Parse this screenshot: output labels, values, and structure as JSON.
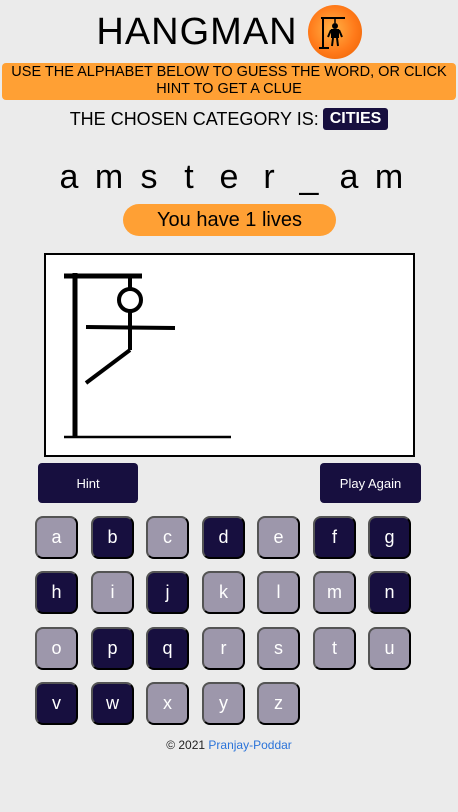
{
  "header": {
    "title": "HANGMAN",
    "logo_icon": "hangman-logo-icon"
  },
  "instructions": "USE THE ALPHABET BELOW TO GUESS THE WORD, OR CLICK HINT TO GET A CLUE",
  "category": {
    "label": "THE CHOSEN CATEGORY IS:",
    "value": "CITIES"
  },
  "word": [
    "a",
    "m",
    "s",
    "t",
    "e",
    "r",
    "_",
    "a",
    "m"
  ],
  "lives_text": "You have 1 lives",
  "buttons": {
    "hint": "Hint",
    "play_again": "Play Again"
  },
  "keyboard": [
    {
      "letter": "a",
      "used": true
    },
    {
      "letter": "b",
      "used": false
    },
    {
      "letter": "c",
      "used": true
    },
    {
      "letter": "d",
      "used": false
    },
    {
      "letter": "e",
      "used": true
    },
    {
      "letter": "f",
      "used": false
    },
    {
      "letter": "g",
      "used": false
    },
    {
      "letter": "h",
      "used": false
    },
    {
      "letter": "i",
      "used": true
    },
    {
      "letter": "j",
      "used": false
    },
    {
      "letter": "k",
      "used": true
    },
    {
      "letter": "l",
      "used": true
    },
    {
      "letter": "m",
      "used": true
    },
    {
      "letter": "n",
      "used": false
    },
    {
      "letter": "o",
      "used": true
    },
    {
      "letter": "p",
      "used": false
    },
    {
      "letter": "q",
      "used": false
    },
    {
      "letter": "r",
      "used": true
    },
    {
      "letter": "s",
      "used": true
    },
    {
      "letter": "t",
      "used": true
    },
    {
      "letter": "u",
      "used": true
    },
    {
      "letter": "v",
      "used": false
    },
    {
      "letter": "w",
      "used": false
    },
    {
      "letter": "x",
      "used": true
    },
    {
      "letter": "y",
      "used": true
    },
    {
      "letter": "z",
      "used": true
    }
  ],
  "footer": {
    "copyright": "© 2021",
    "author": "Pranjay-Poddar"
  },
  "colors": {
    "accent": "#ffa034",
    "dark": "#170f3f",
    "used_key": "#9d97ab",
    "background": "#ebebeb",
    "link": "#2a73d9"
  }
}
